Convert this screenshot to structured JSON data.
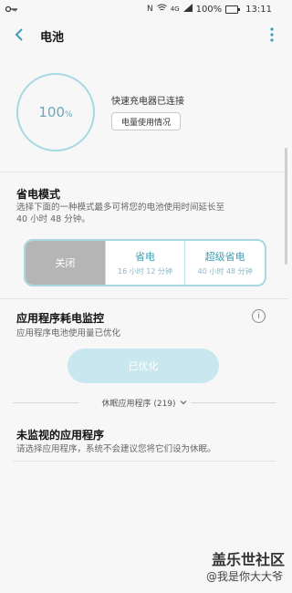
{
  "status": {
    "battery": "100%",
    "time": "13:11",
    "signal": "4G"
  },
  "appbar": {
    "title": "电池"
  },
  "battery": {
    "level_label": "100",
    "unit": "%",
    "charger_status": "快速充电器已连接",
    "usage_button": "电量使用情况"
  },
  "power_saving": {
    "title": "省电模式",
    "description": "选择下面的一种模式最多可将您的电池使用时间延长至 40 小时 48 分钟。",
    "modes": [
      {
        "title": "关闭",
        "subtitle": ""
      },
      {
        "title": "省电",
        "subtitle": "16 小时 12 分钟"
      },
      {
        "title": "超级省电",
        "subtitle": "40 小时 48 分钟"
      }
    ]
  },
  "monitor": {
    "title": "应用程序耗电监控",
    "subtitle": "应用程序电池使用量已优化",
    "optimize_button": "已优化",
    "sleep_apps": "休眠应用程序 (219)"
  },
  "unmonitored": {
    "title": "未监视的应用程序",
    "subtitle": "请选择应用程序，系统不会建议您将它们设为休眠。"
  },
  "watermark": {
    "line1": "盖乐世社区",
    "line2": "@我是你大大爷"
  }
}
